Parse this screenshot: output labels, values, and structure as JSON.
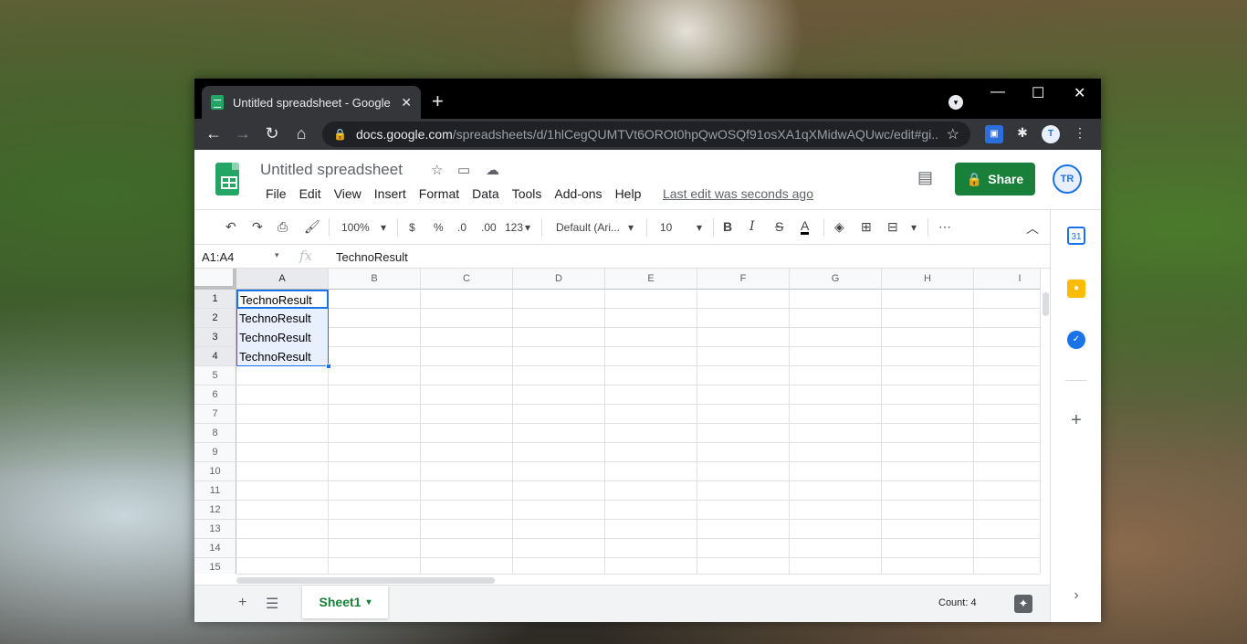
{
  "browser": {
    "tab_title": "Untitled spreadsheet - Google Sh",
    "new_tab": "+",
    "url_host": "docs.google.com",
    "url_path": "/spreadsheets/d/1hlCegQUMTVt6OROt0hpQwOSQf91osXA1qXMidwAQUwc/edit#gi..."
  },
  "sheets": {
    "title": "Untitled spreadsheet",
    "menu": [
      "File",
      "Edit",
      "View",
      "Insert",
      "Format",
      "Data",
      "Tools",
      "Add-ons",
      "Help"
    ],
    "last_edit": "Last edit was seconds ago",
    "share_label": "Share",
    "toolbar": {
      "zoom": "100%",
      "currency": "$",
      "percent": "%",
      "dec_decrease": ".0",
      "dec_increase": ".00",
      "more_formats": "123",
      "font": "Default (Ari...",
      "font_size": "10"
    },
    "formula_bar": {
      "range": "A1:A4",
      "fx": "fx",
      "content": "TechnoResult"
    },
    "columns": [
      "A",
      "B",
      "C",
      "D",
      "E",
      "F",
      "G",
      "H",
      "I"
    ],
    "rows": [
      "1",
      "2",
      "3",
      "4",
      "5",
      "6",
      "7",
      "8",
      "9",
      "10",
      "11",
      "12",
      "13",
      "14",
      "15"
    ],
    "cells_a": [
      "TechnoResult",
      "TechnoResult",
      "TechnoResult",
      "TechnoResult"
    ],
    "sheet_tab": "Sheet1",
    "count": "Count: 4"
  },
  "colors": {
    "accent": "#1a73e8",
    "sheets_green": "#188038",
    "chrome_dark": "#35363a"
  }
}
